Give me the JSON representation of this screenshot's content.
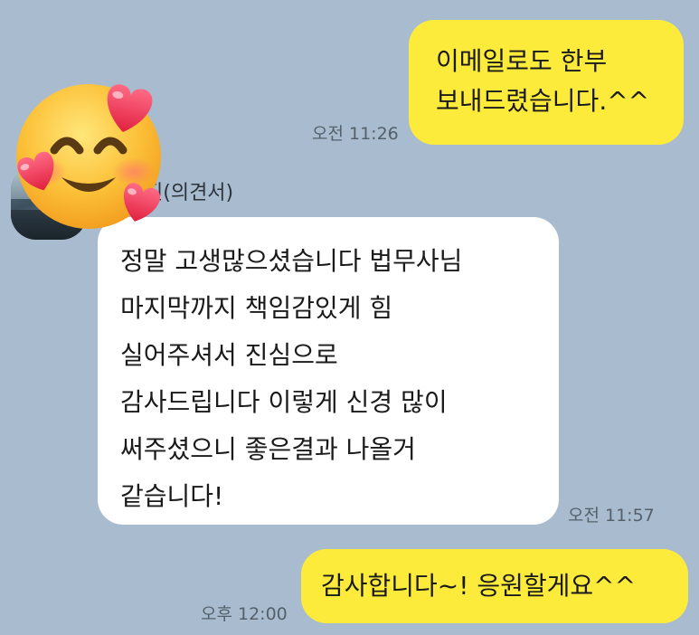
{
  "messages": [
    {
      "id": "m1",
      "side": "mine",
      "lines": [
        "이메일로도 한부",
        "보내드렸습니다.^^"
      ],
      "time": "오전 11:26"
    },
    {
      "id": "m2",
      "side": "theirs",
      "sender": "진(의견서)",
      "lines": [
        "정말 고생많으셨습니다 법무사님",
        "마지막까지 책임감있게 힘",
        "실어주셔서 진심으로",
        "감사드립니다 이렇게 신경 많이",
        "써주셨으니 좋은결과 나올거",
        "같습니다!"
      ],
      "time": "오전 11:57"
    },
    {
      "id": "m3",
      "side": "mine",
      "lines": [
        "감사합니다~! 응원할게요^^"
      ],
      "time": "오후 12:00"
    }
  ],
  "sticker": {
    "icon": "smiling-face-with-hearts-icon"
  },
  "colors": {
    "background": "#a9bccf",
    "my_bubble": "#fdeb3c",
    "their_bubble": "#ffffff"
  }
}
